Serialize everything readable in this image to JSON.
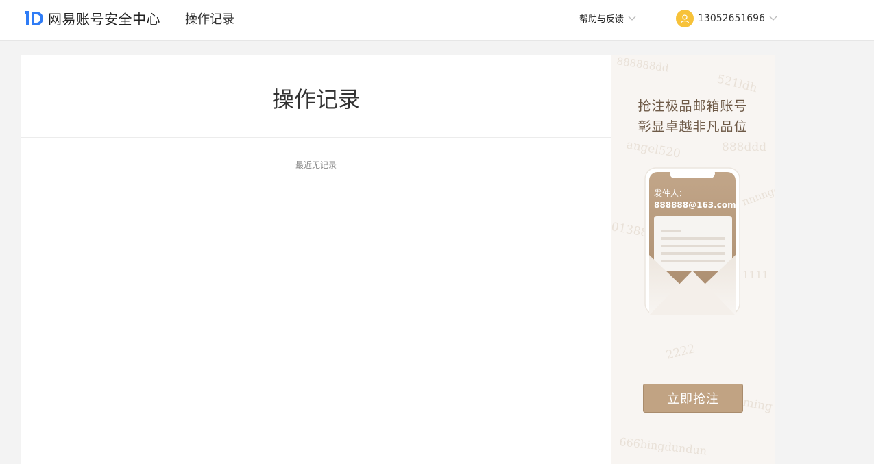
{
  "header": {
    "brand": "网易账号安全中心",
    "page_name": "操作记录",
    "help_label": "帮助与反馈",
    "username": "13052651696",
    "icons": {
      "logo": "netease-id-logo",
      "help_chevron": "chevron-down-icon",
      "user_chevron": "chevron-down-icon",
      "avatar": "user-avatar-icon"
    }
  },
  "main": {
    "title": "操作记录",
    "empty_text": "最近无记录"
  },
  "promo": {
    "line1": "抢注极品邮箱账号",
    "line2": "彰显卓越非凡品位",
    "sender_label": "发件人：",
    "sender_email": "888888@163.com",
    "cta_label": "立即抢注",
    "watermarks": [
      "888888dd",
      "521ldh",
      "angel520",
      "888ddd",
      "nnnngg",
      "01388",
      "1111",
      "2222",
      "ming",
      "666bingdundun"
    ]
  },
  "colors": {
    "brand_blue": "#2f7cf6",
    "avatar_yellow": "#f7c239",
    "cta_gold": "#c1a383",
    "page_bg": "#f3f3f3"
  }
}
